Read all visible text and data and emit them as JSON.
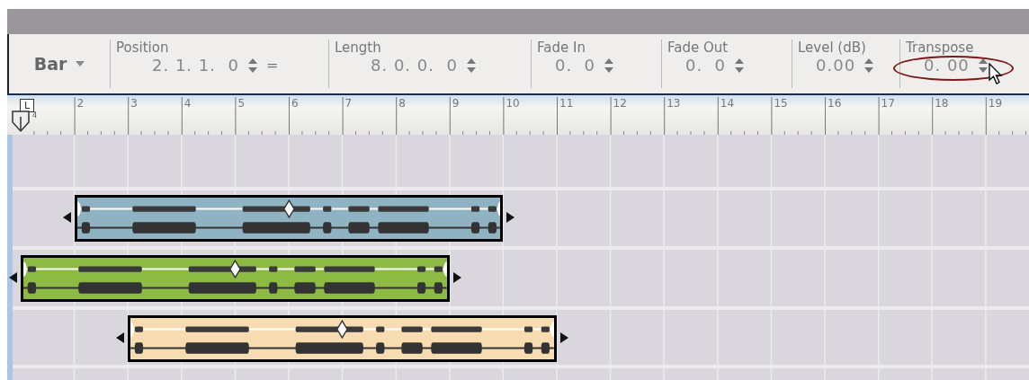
{
  "toolbar": {
    "unit": "Bar",
    "fields": [
      {
        "label": "Position",
        "value": "2. 1. 1.  0",
        "link": true
      },
      {
        "label": "Length",
        "value": "8. 0. 0.  0",
        "link": false
      },
      {
        "label": "Fade In",
        "value": "0.  0",
        "link": false
      },
      {
        "label": "Fade Out",
        "value": "0.  0",
        "link": false
      },
      {
        "label": "Level (dB)",
        "value": "0.00",
        "link": false
      },
      {
        "label": "Transpose",
        "value": "0. 00",
        "link": false,
        "highlighted": true
      }
    ],
    "link_symbol": "="
  },
  "ruler": {
    "marker": "L",
    "marker_sub": "4",
    "bars": [
      "2",
      "3",
      "4",
      "5",
      "6",
      "7",
      "8",
      "9",
      "10",
      "11",
      "12",
      "13",
      "14",
      "15",
      "16",
      "17",
      "18",
      "19"
    ]
  },
  "clips": [
    {
      "color": "#8fb3c2"
    },
    {
      "color": "#8cba43"
    },
    {
      "color": "#f7dcb1"
    }
  ]
}
